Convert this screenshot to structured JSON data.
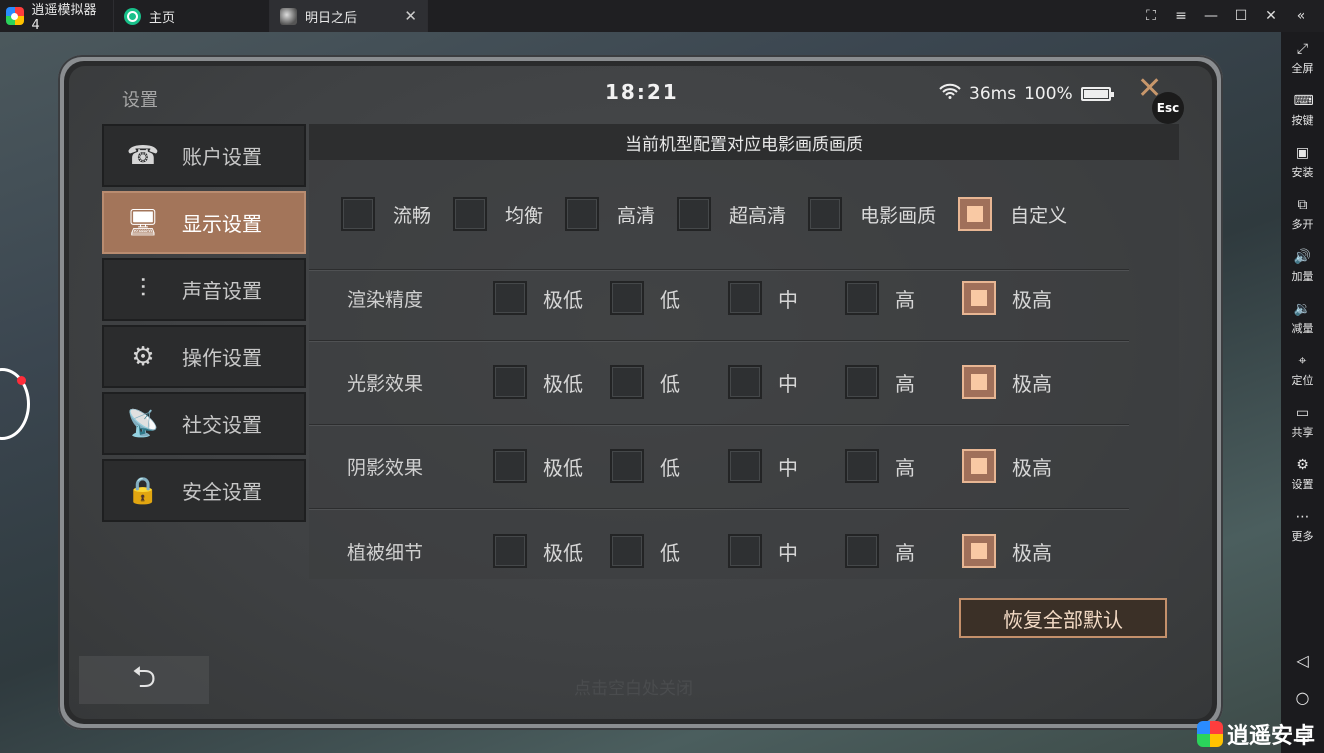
{
  "tabs": {
    "app": "逍遥模拟器4",
    "home": "主页",
    "game": "明日之后",
    "close": "✕"
  },
  "window_controls": [
    "⛶",
    "≡",
    "—",
    "☐",
    "✕",
    "«"
  ],
  "sidebar": [
    {
      "icon": "fullscreen-icon",
      "glyph": "⤢",
      "label": "全屏"
    },
    {
      "icon": "keyboard-icon",
      "glyph": "⌨",
      "label": "按键"
    },
    {
      "icon": "apk-icon",
      "glyph": "▣",
      "label": "安装"
    },
    {
      "icon": "multi-instance-icon",
      "glyph": "⧉",
      "label": "多开"
    },
    {
      "icon": "volume-up-icon",
      "glyph": "🔊",
      "label": "加量"
    },
    {
      "icon": "volume-down-icon",
      "glyph": "🔉",
      "label": "减量"
    },
    {
      "icon": "location-icon",
      "glyph": "⌖",
      "label": "定位"
    },
    {
      "icon": "folder-icon",
      "glyph": "▭",
      "label": "共享"
    },
    {
      "icon": "gear-icon",
      "glyph": "⚙",
      "label": "设置"
    },
    {
      "icon": "more-icon",
      "glyph": "⋯",
      "label": "更多"
    }
  ],
  "nav": {
    "back": "◁",
    "home": "○",
    "recent": "□"
  },
  "screen": {
    "title": "设置",
    "clock": "18:21",
    "ping": "36ms",
    "battery": "100%",
    "esc": "Esc",
    "close": "✕"
  },
  "menu": [
    {
      "label": "账户设置",
      "icon": "account-icon",
      "glyph": "☎",
      "active": false
    },
    {
      "label": "显示设置",
      "icon": "display-icon",
      "glyph": "🖥",
      "active": true
    },
    {
      "label": "声音设置",
      "icon": "sound-icon",
      "glyph": "⫶",
      "active": false
    },
    {
      "label": "操作设置",
      "icon": "controls-icon",
      "glyph": "⚙",
      "active": false
    },
    {
      "label": "社交设置",
      "icon": "social-icon",
      "glyph": "📡",
      "active": false
    },
    {
      "label": "安全设置",
      "icon": "security-icon",
      "glyph": "🔒",
      "active": false
    }
  ],
  "content": {
    "header": "当前机型配置对应电影画质画质",
    "presets": [
      {
        "label": "流畅",
        "checked": false
      },
      {
        "label": "均衡",
        "checked": false
      },
      {
        "label": "高清",
        "checked": false
      },
      {
        "label": "超高清",
        "checked": false
      },
      {
        "label": "电影画质",
        "checked": false
      },
      {
        "label": "自定义",
        "checked": true
      }
    ],
    "levels": [
      "极低",
      "低",
      "中",
      "高",
      "极高"
    ],
    "rows": [
      {
        "label": "渲染精度",
        "selected": 4
      },
      {
        "label": "光影效果",
        "selected": 4
      },
      {
        "label": "阴影效果",
        "selected": 4
      },
      {
        "label": "植被细节",
        "selected": 4
      }
    ]
  },
  "reset": "恢复全部默认",
  "back": "⮌",
  "hint": "点击空白处关闭",
  "watermark": "逍遥安卓"
}
